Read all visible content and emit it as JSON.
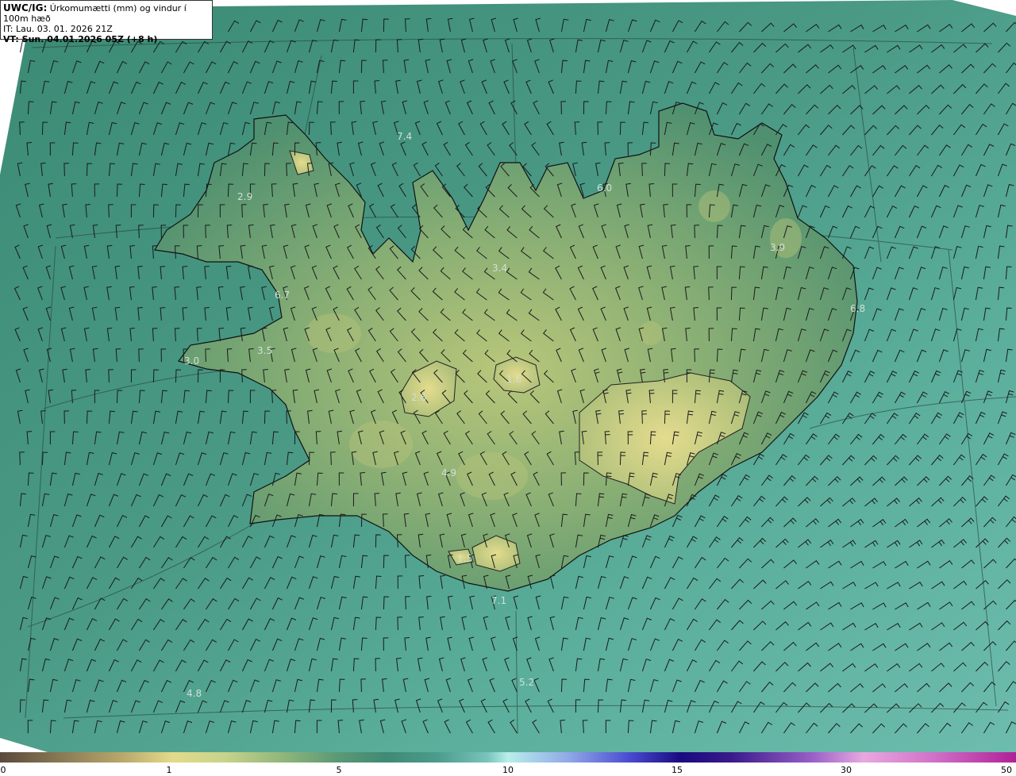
{
  "header": {
    "product": "UWC/IG:",
    "description": "Úrkomumætti (mm) og vindur í 100m hæð",
    "issue_time": "IT: Lau. 03. 01. 2026 21Z",
    "valid_time": "VT: Sun. 04.01.2026 05Z (+8 h)"
  },
  "map_labels": [
    {
      "text": "7.4"
    },
    {
      "text": "2.9"
    },
    {
      "text": "3.4"
    },
    {
      "text": "3.9"
    },
    {
      "text": "6.8"
    },
    {
      "text": "6.7"
    },
    {
      "text": "3.5"
    },
    {
      "text": "3.0"
    },
    {
      "text": "4.9"
    },
    {
      "text": "7.1"
    },
    {
      "text": "5.2"
    },
    {
      "text": "4.8"
    },
    {
      "text": "2.6"
    },
    {
      "text": "1.6"
    },
    {
      "text": "1.5"
    },
    {
      "text": "6.0"
    }
  ],
  "colorbar": {
    "ticks": [
      "0",
      "1",
      "5",
      "10",
      "15",
      "30",
      "50"
    ]
  },
  "colors": {
    "sea_base": "#3f8f7a",
    "sea_light": "#6dbfae",
    "land_low": "#5a9a72",
    "land_high": "#c8d07a",
    "coast": "#111111",
    "barb": "#1a1a1a"
  }
}
